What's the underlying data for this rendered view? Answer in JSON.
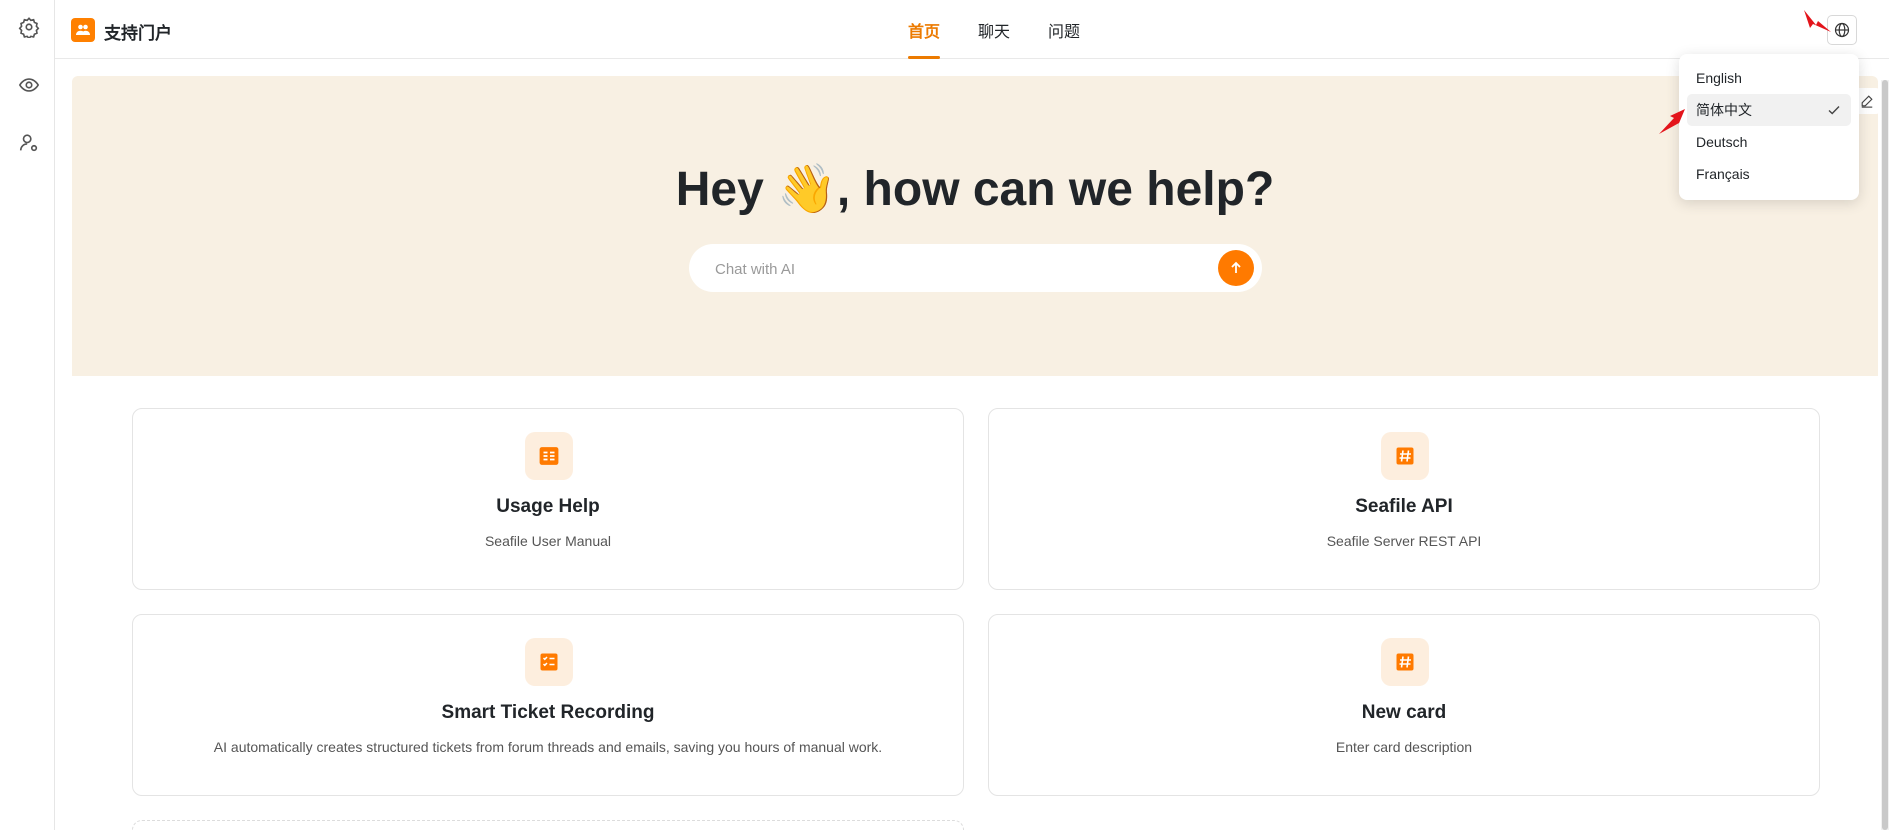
{
  "app": {
    "title": "支持门户",
    "logo_icon": "users-icon",
    "accent_color": "#ff7a00"
  },
  "rail": {
    "items": [
      {
        "name": "settings",
        "icon": "gear-icon"
      },
      {
        "name": "preview",
        "icon": "eye-icon"
      },
      {
        "name": "user-settings",
        "icon": "user-gear-icon"
      }
    ]
  },
  "nav": {
    "tabs": [
      {
        "label": "首页",
        "active": true
      },
      {
        "label": "聊天",
        "active": false
      },
      {
        "label": "问题",
        "active": false
      }
    ]
  },
  "header": {
    "language_icon": "globe-icon"
  },
  "hero": {
    "title": "Hey 👋, how can we help?",
    "chat_placeholder": "Chat with AI",
    "send_icon": "arrow-up-icon",
    "edit_icon": "edit-icon"
  },
  "cards": [
    {
      "icon": "list-icon",
      "title": "Usage Help",
      "description": "Seafile User Manual"
    },
    {
      "icon": "hash-icon",
      "title": "Seafile API",
      "description": "Seafile Server REST API"
    },
    {
      "icon": "checklist-icon",
      "title": "Smart Ticket Recording",
      "description": "AI automatically creates structured tickets from forum threads and emails, saving you hours of manual work."
    },
    {
      "icon": "hash-icon",
      "title": "New card",
      "description": "Enter card description"
    }
  ],
  "language_menu": {
    "options": [
      {
        "label": "English",
        "selected": false
      },
      {
        "label": "简体中文",
        "selected": true
      },
      {
        "label": "Deutsch",
        "selected": false
      },
      {
        "label": "Français",
        "selected": false
      }
    ]
  }
}
